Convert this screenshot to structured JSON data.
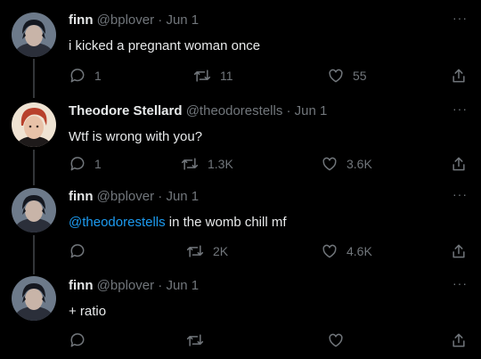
{
  "tweets": [
    {
      "name": "finn",
      "handle": "@bplover",
      "separator": "·",
      "date": "Jun 1",
      "text": "i kicked a pregnant woman once",
      "replies": "1",
      "retweets": "11",
      "likes": "55",
      "avatar": "dark-haired-character-avatar"
    },
    {
      "name": "Theodore Stellard",
      "handle": "@theodorestells",
      "separator": "·",
      "date": "Jun 1",
      "text": "Wtf is wrong with you?",
      "replies": "1",
      "retweets": "1.3K",
      "likes": "3.6K",
      "avatar": "red-haired-character-avatar"
    },
    {
      "name": "finn",
      "handle": "@bplover",
      "separator": "·",
      "date": "Jun 1",
      "mention": "@theodorestells",
      "text": " in the womb chill mf",
      "replies": "",
      "retweets": "2K",
      "likes": "4.6K",
      "avatar": "dark-haired-character-avatar"
    },
    {
      "name": "finn",
      "handle": "@bplover",
      "separator": "·",
      "date": "Jun 1",
      "text": "+ ratio",
      "replies": "",
      "retweets": "",
      "likes": "",
      "avatar": "dark-haired-character-avatar"
    }
  ],
  "more_label": "···",
  "colors": {
    "background": "#000000",
    "primary_text": "#e7e9ea",
    "secondary_text": "#71767b",
    "link": "#1d9bf0",
    "thread_line": "#333639"
  },
  "icons": [
    "reply-icon",
    "retweet-icon",
    "like-icon",
    "share-icon",
    "more-icon"
  ]
}
